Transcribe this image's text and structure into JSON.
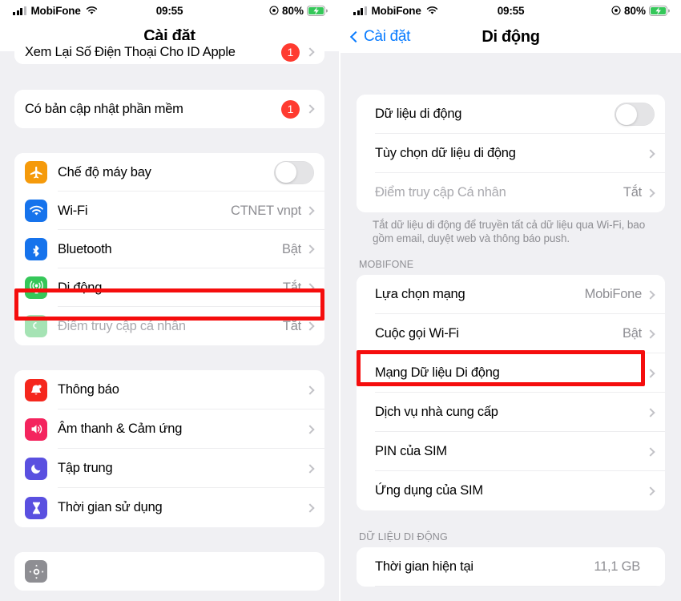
{
  "status_bar": {
    "carrier": "MobiFone",
    "time": "09:55",
    "battery_percent": "80%",
    "wifi_icon": "wifi-icon",
    "signal_icon": "cellular-bars-icon",
    "location_icon": "location-services-icon",
    "battery_icon": "battery-charging-icon"
  },
  "left_screen": {
    "nav": {
      "title": "Cài đặt"
    },
    "partial_top_row": {
      "label": "Xem Lại Số Điện Thoại Cho ID Apple",
      "badge": "1"
    },
    "group_update": [
      {
        "label": "Có bản cập nhật phần mềm",
        "badge": "1",
        "chevron": true
      }
    ],
    "group_connectivity": [
      {
        "icon": "airplane-icon",
        "icon_color": "#f59a0b",
        "label": "Chế độ máy bay",
        "control": "toggle",
        "toggle_on": false
      },
      {
        "icon": "wifi-icon",
        "icon_color": "#1673ec",
        "label": "Wi-Fi",
        "value": "CTNET vnpt",
        "chevron": true
      },
      {
        "icon": "bluetooth-icon",
        "icon_color": "#1673ec",
        "label": "Bluetooth",
        "value": "Bật",
        "chevron": true
      },
      {
        "icon": "cellular-icon",
        "icon_color": "#35c759",
        "label": "Di động",
        "value": "Tắt",
        "chevron": true,
        "highlighted": true
      },
      {
        "icon": "hotspot-icon",
        "icon_color": "#a5e3b4",
        "label": "Điểm truy cập cá nhân",
        "value": "Tắt",
        "chevron": true,
        "dimmed": true
      }
    ],
    "group_system": [
      {
        "icon": "bell-icon",
        "icon_color": "#f5271d",
        "label": "Thông báo",
        "chevron": true
      },
      {
        "icon": "speaker-icon",
        "icon_color": "#f4245e",
        "label": "Âm thanh & Cảm ứng",
        "chevron": true
      },
      {
        "icon": "moon-icon",
        "icon_color": "#5a50e0",
        "label": "Tập trung",
        "chevron": true
      },
      {
        "icon": "hourglass-icon",
        "icon_color": "#5a50e0",
        "label": "Thời gian sử dụng",
        "chevron": true
      }
    ],
    "partial_bottom_row": {
      "icon": "gear-icon",
      "icon_color": "#8e8e93"
    }
  },
  "right_screen": {
    "nav": {
      "back_label": "Cài đặt",
      "title": "Di động"
    },
    "group_data": [
      {
        "label": "Dữ liệu di động",
        "control": "toggle",
        "toggle_on": false
      },
      {
        "label": "Tùy chọn dữ liệu di động",
        "chevron": true
      },
      {
        "label": "Điểm truy cập Cá nhân",
        "value": "Tắt",
        "chevron": true,
        "dimmed": true
      }
    ],
    "footnote": "Tắt dữ liệu di động để truyền tất cả dữ liệu qua Wi-Fi, bao gồm email, duyệt web và thông báo push.",
    "group_carrier_header": "MOBIFONE",
    "group_carrier": [
      {
        "label": "Lựa chọn mạng",
        "value": "MobiFone",
        "chevron": true
      },
      {
        "label": "Cuộc gọi Wi-Fi",
        "value": "Bật",
        "chevron": true
      },
      {
        "label": "Mạng Dữ liệu Di động",
        "chevron": true,
        "highlighted": true
      },
      {
        "label": "Dịch vụ nhà cung cấp",
        "chevron": true
      },
      {
        "label": "PIN của SIM",
        "chevron": true
      },
      {
        "label": "Ứng dụng của SIM",
        "chevron": true
      }
    ],
    "group_usage_header": "DỮ LIỆU DI ĐỘNG",
    "group_usage": [
      {
        "label": "Thời gian hiện tại",
        "value": "11,1 GB"
      }
    ]
  },
  "colors": {
    "accent_blue": "#0a7cff",
    "highlight_red": "#f50d0d",
    "badge_red": "#ff3b30",
    "background": "#f0f0f3"
  }
}
